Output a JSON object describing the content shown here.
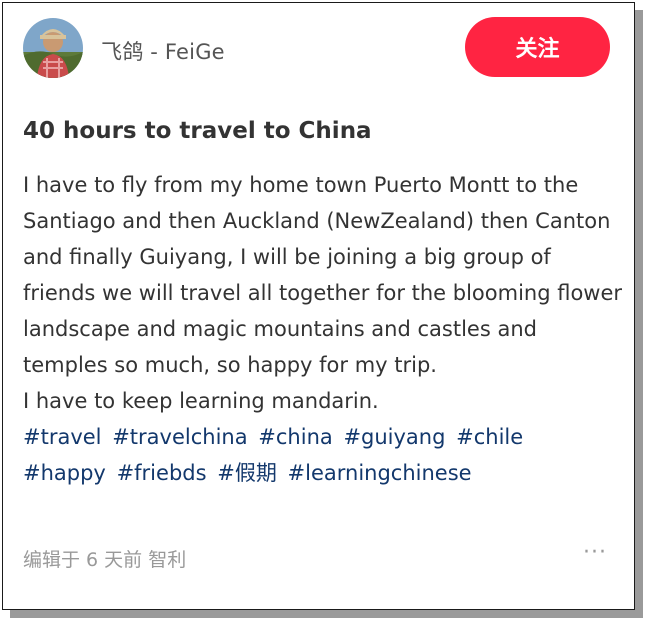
{
  "post": {
    "author": {
      "name": "飞鸽 - FeiGe",
      "avatar_icon": "profile-photo"
    },
    "follow_button": "关注",
    "title": "40 hours to travel to China",
    "paragraphs": [
      "I have to fly from my home town Puerto Montt to the Santiago and then Auckland (NewZealand) then Canton and finally Guiyang, I will be joining a big group of friends we will travel all together for the blooming flower landscape and magic mountains and castles and temples so much, so happy for my trip.",
      "I have to keep learning mandarin."
    ],
    "hashtags": [
      "#travel",
      "#travelchina",
      "#china",
      "#guiyang",
      "#chile",
      "#happy",
      "#friebds",
      "#假期",
      "#learningchinese"
    ],
    "meta": "编辑于 6 天前 智利",
    "more_icon": "···"
  },
  "colors": {
    "accent": "#ff2442",
    "hashtag": "#13386c",
    "text": "#333333",
    "muted": "#999999"
  }
}
